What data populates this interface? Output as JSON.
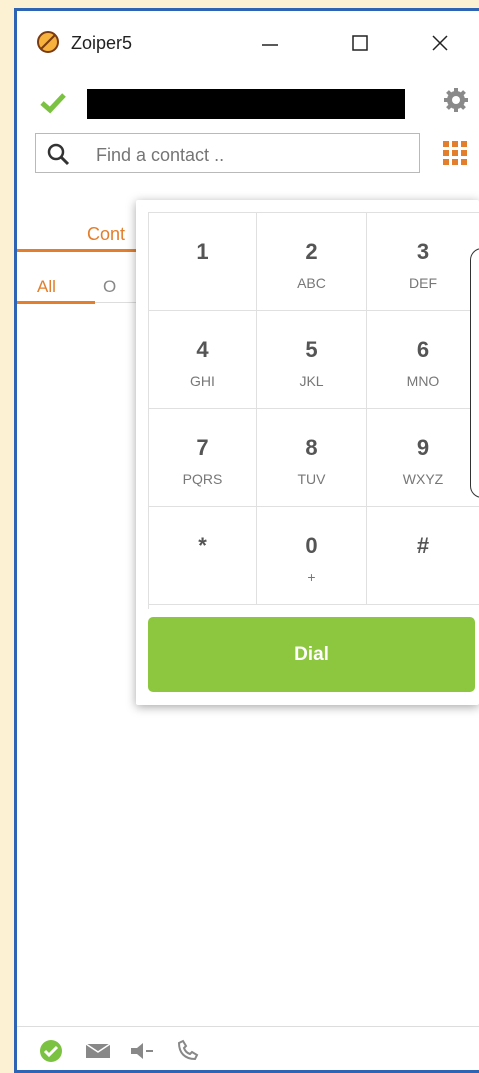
{
  "window": {
    "title": "Zoiper5"
  },
  "status": {
    "state": "registered"
  },
  "search": {
    "placeholder": "Find a contact .."
  },
  "tabs": {
    "contacts_visible": "Cont",
    "all": "All",
    "other_visible": "O"
  },
  "keypad": [
    {
      "digit": "1",
      "letters": ""
    },
    {
      "digit": "2",
      "letters": "ABC"
    },
    {
      "digit": "3",
      "letters": "DEF"
    },
    {
      "digit": "4",
      "letters": "GHI"
    },
    {
      "digit": "5",
      "letters": "JKL"
    },
    {
      "digit": "6",
      "letters": "MNO"
    },
    {
      "digit": "7",
      "letters": "PQRS"
    },
    {
      "digit": "8",
      "letters": "TUV"
    },
    {
      "digit": "9",
      "letters": "WXYZ"
    },
    {
      "digit": "*",
      "letters": ""
    },
    {
      "digit": "0",
      "letters": "+"
    },
    {
      "digit": "#",
      "letters": ""
    }
  ],
  "dial": {
    "label": "Dial"
  },
  "colors": {
    "accent": "#e27e2c",
    "dial_green": "#8dc63f",
    "status_green": "#7cc242",
    "border_blue": "#2d64b3"
  },
  "footer_icons": [
    "status-online-icon",
    "message-icon",
    "speaker-icon",
    "phone-settings-icon"
  ]
}
